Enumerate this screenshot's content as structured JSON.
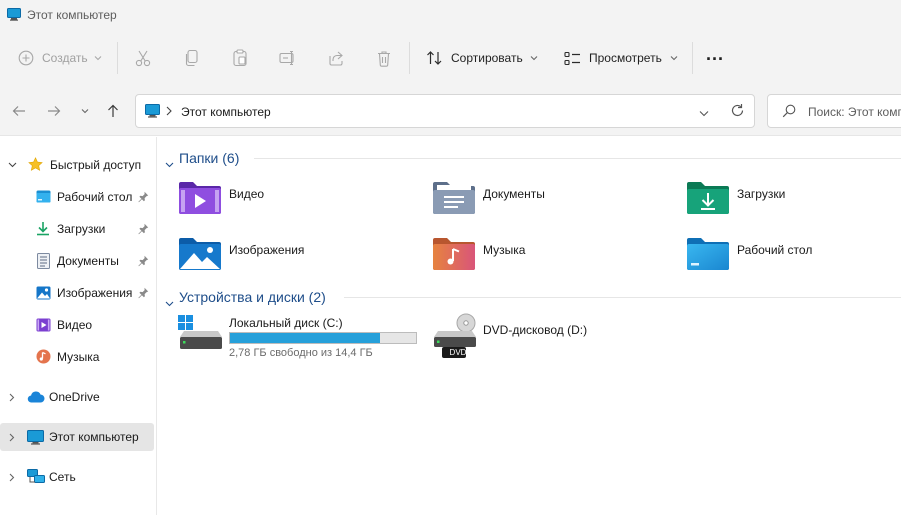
{
  "window": {
    "title": "Этот компьютер"
  },
  "toolbar": {
    "create_label": "Создать",
    "sort_label": "Сортировать",
    "view_label": "Просмотреть",
    "more_label": "..."
  },
  "address": {
    "path": [
      "Этот компьютер"
    ],
    "search_placeholder": "Поиск: Этот компьютер"
  },
  "sidebar": {
    "items": [
      {
        "label": "Быстрый доступ",
        "icon": "star-icon"
      },
      {
        "label": "Рабочий стол",
        "icon": "desktop-folder-icon",
        "pinned": true
      },
      {
        "label": "Загрузки",
        "icon": "download-icon",
        "pinned": true
      },
      {
        "label": "Документы",
        "icon": "documents-icon",
        "pinned": true
      },
      {
        "label": "Изображения",
        "icon": "pictures-icon",
        "pinned": true
      },
      {
        "label": "Видео",
        "icon": "video-icon"
      },
      {
        "label": "Музыка",
        "icon": "music-icon"
      },
      {
        "label": "OneDrive",
        "icon": "cloud-icon"
      },
      {
        "label": "Этот компьютер",
        "icon": "computer-icon",
        "selected": true
      },
      {
        "label": "Сеть",
        "icon": "network-icon"
      }
    ]
  },
  "main": {
    "folders_header": "Папки (6)",
    "folders": [
      {
        "label": "Видео",
        "icon": "video-folder-icon"
      },
      {
        "label": "Документы",
        "icon": "documents-folder-icon"
      },
      {
        "label": "Загрузки",
        "icon": "downloads-folder-icon"
      },
      {
        "label": "Изображения",
        "icon": "pictures-folder-icon"
      },
      {
        "label": "Музыка",
        "icon": "music-folder-icon"
      },
      {
        "label": "Рабочий стол",
        "icon": "desktop-folder-icon"
      }
    ],
    "drives_header": "Устройства и диски (2)",
    "drives": [
      {
        "label": "Локальный диск (C:)",
        "icon": "windows-drive-icon",
        "free_text": "2,78 ГБ свободно из 14,4 ГБ",
        "used_fraction": 0.807
      },
      {
        "label": "DVD-дисковод (D:)",
        "icon": "dvd-drive-icon",
        "badge": "DVD"
      }
    ]
  },
  "colors": {
    "accent": "#0067c0",
    "group_header": "#1f4e8a",
    "usage_bar": "#26a0da"
  }
}
